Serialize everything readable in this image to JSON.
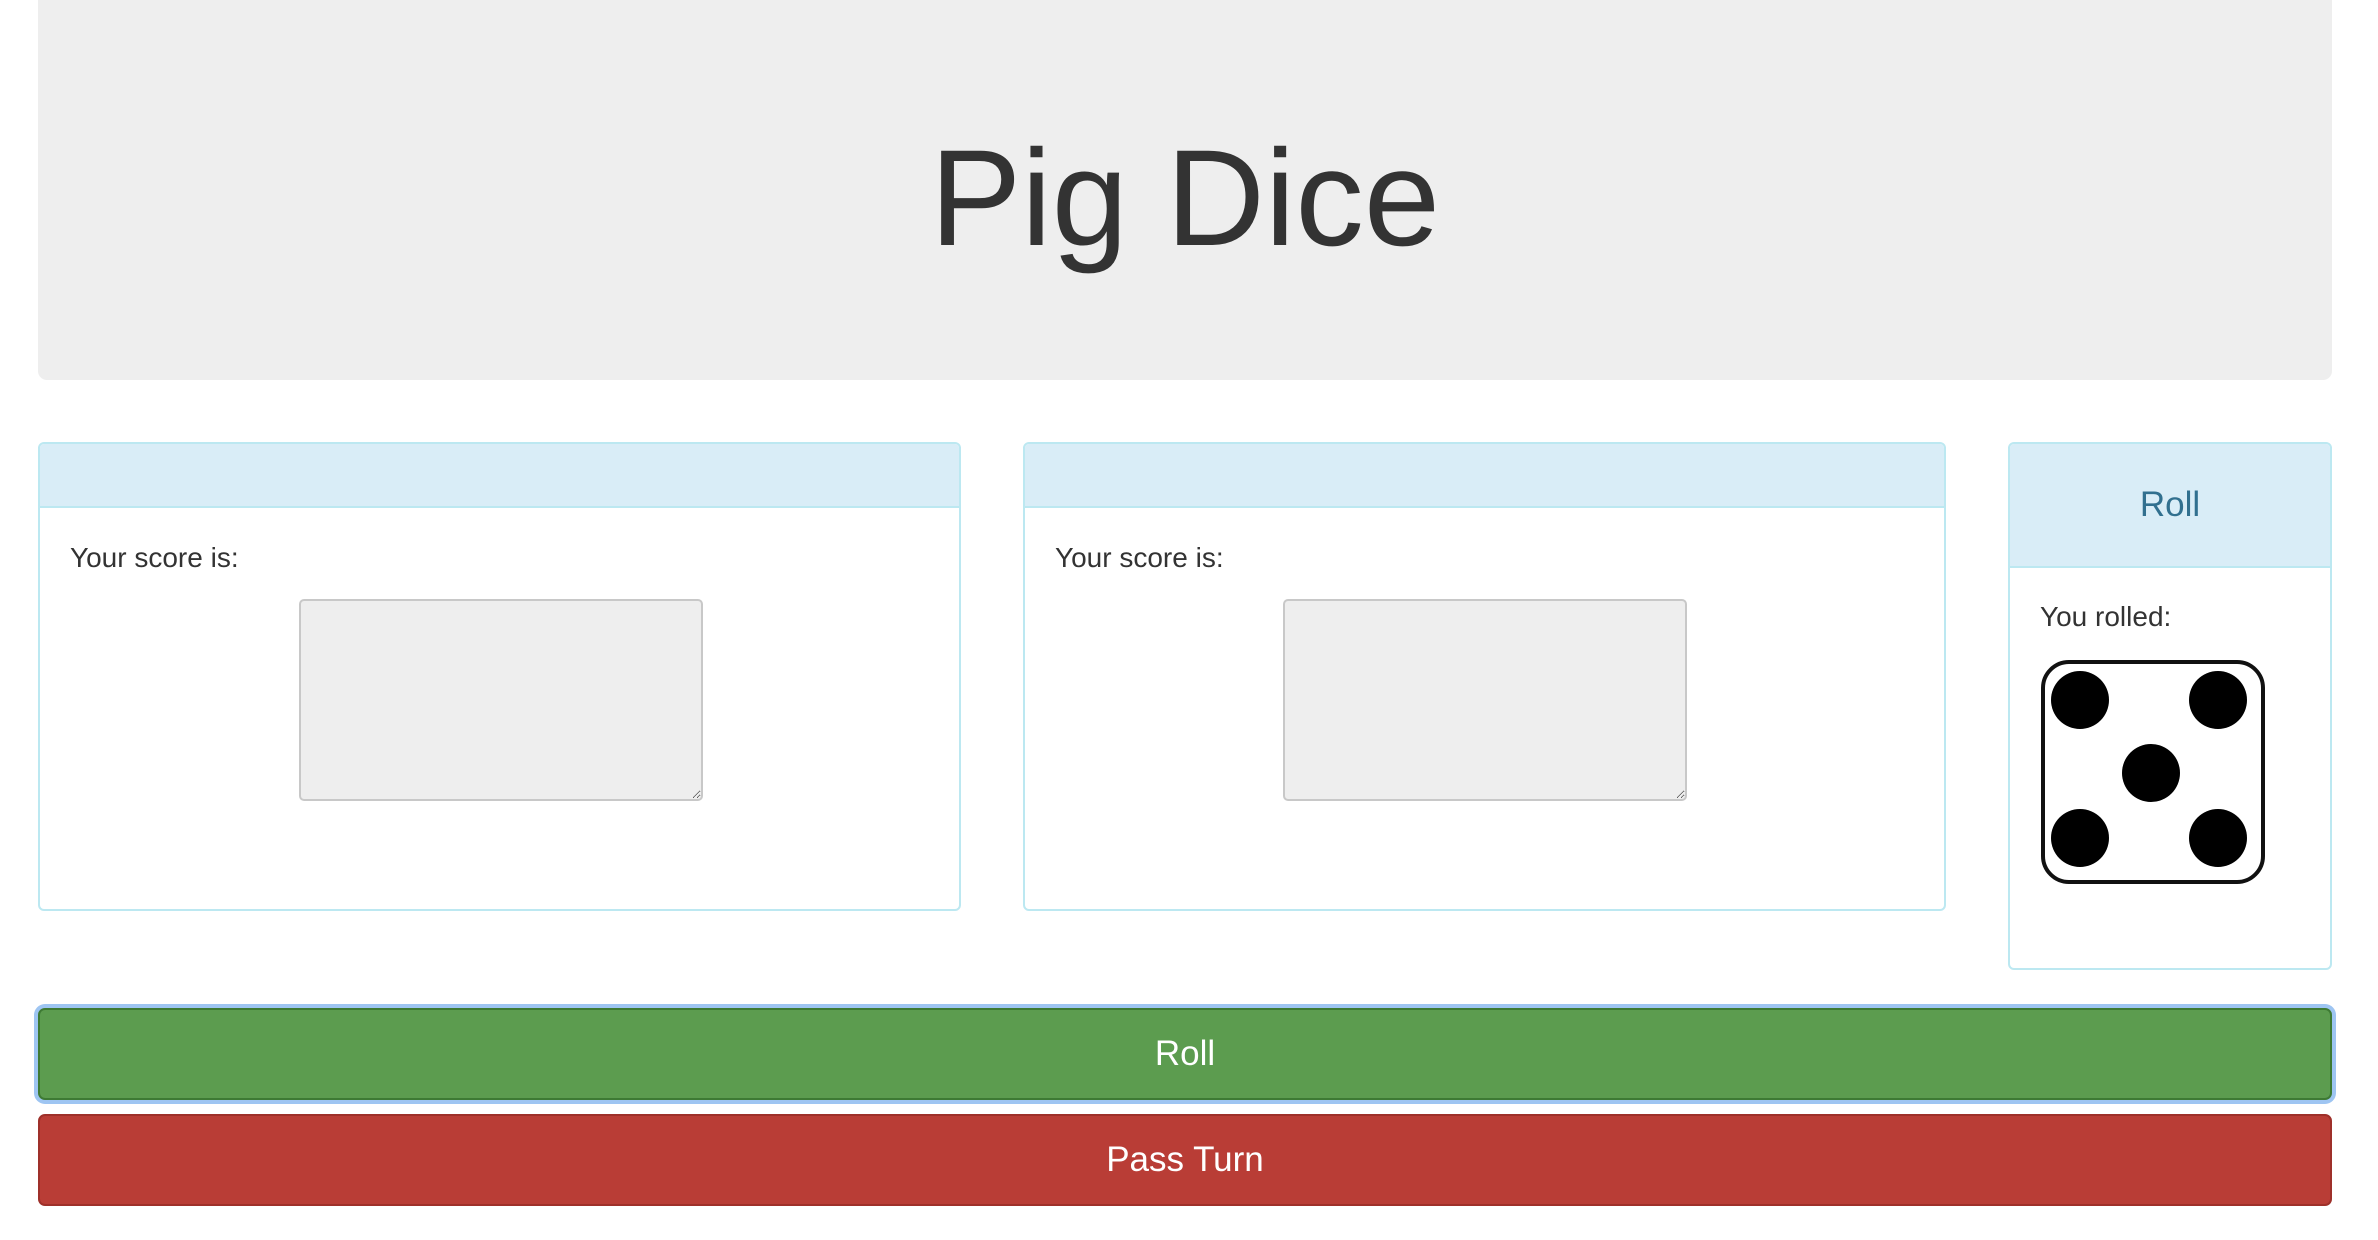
{
  "header": {
    "title": "Pig Dice"
  },
  "players": [
    {
      "name": "",
      "score_label": "Your score is:",
      "score_value": ""
    },
    {
      "name": "",
      "score_label": "Your score is:",
      "score_value": ""
    }
  ],
  "roll_panel": {
    "title": "Roll",
    "label": "You rolled:",
    "die_value": 5,
    "die_icon": "die-five-icon"
  },
  "buttons": {
    "roll_label": "Roll",
    "pass_label": "Pass Turn"
  },
  "colors": {
    "roll_button": "#5c9c4f",
    "pass_button": "#b93d36",
    "panel_heading": "#d9edf7",
    "jumbotron": "#eeeeee"
  }
}
